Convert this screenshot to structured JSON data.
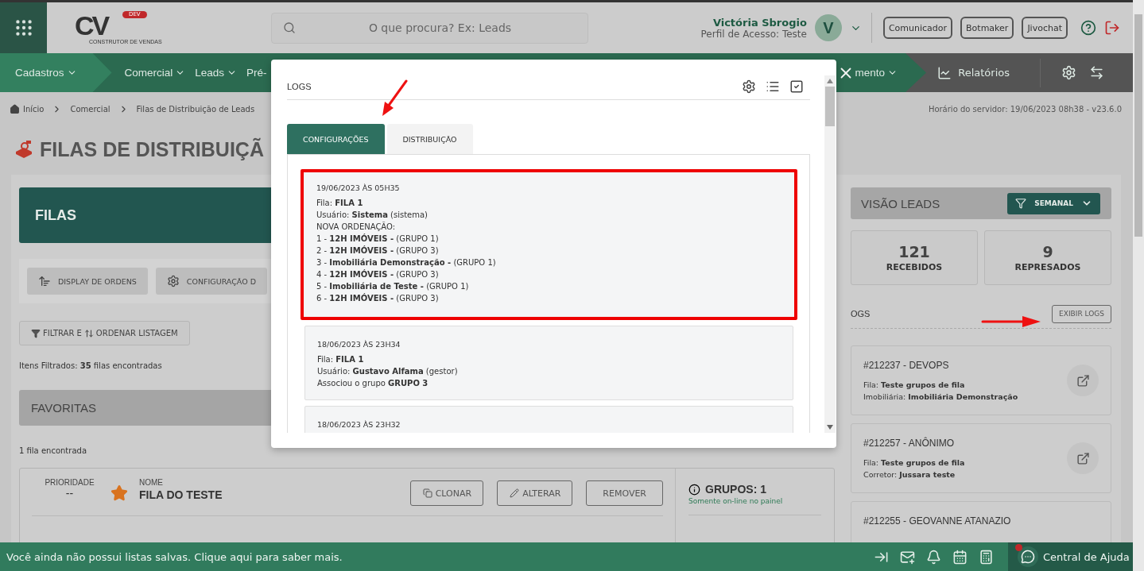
{
  "header": {
    "logo_mark": "CV",
    "logo_badge": "DEV",
    "logo_text": "CONSTRUTOR DE VENDAS",
    "search": {
      "placeholder": "O que procura? Ex: Leads"
    },
    "user": {
      "name": "Victória Sbrogio",
      "profile": "Perfil de Acesso: Teste",
      "initial": "V"
    },
    "buttons": [
      "Comunicador",
      "Botmaker",
      "Jivochat"
    ]
  },
  "nav": {
    "items": [
      {
        "label": "Cadastros",
        "selected": true
      },
      {
        "label": "Comercial",
        "selected": false
      },
      {
        "label": "Leads",
        "selected": false
      },
      {
        "label": "Pré-",
        "selected": false
      }
    ],
    "trailing": {
      "label": "mento",
      "selected": false
    },
    "reports": "Relatórios"
  },
  "breadcrumb": [
    "Início",
    "Comercial",
    "Filas de Distribuição de Leads"
  ],
  "server_time": "Horário do servidor: 19/06/2023 08h38 - v23.6.0",
  "page_title": "FILAS DE DISTRIBUIÇÃ",
  "filas": {
    "title": "FILAS",
    "actions": [
      "DISPLAY DE ORDENS",
      "CONFIGURAÇÃO D"
    ],
    "filter_button": [
      "FILTRAR E",
      "ORDENAR LISTAGEM"
    ],
    "count_text": "Itens Filtrados: **35** filas encontradas",
    "favorites": {
      "title": "FAVORITAS",
      "count_text": "1 fila encontrada",
      "queue": {
        "priority_label": "PRIORIDADE",
        "priority": "--",
        "favorite": true,
        "name_label": "NOME",
        "name": "FILA DO TESTE",
        "buttons": [
          "CLONAR",
          "ALTERAR",
          "REMOVER"
        ],
        "groups": "GRUPOS: 1",
        "groups_note": "Somente on-line no painel"
      }
    }
  },
  "overview": {
    "title": "VISÃO LEADS",
    "filter": "SEMANAL",
    "stats": [
      {
        "value": "121",
        "label": "RECEBIDOS"
      },
      {
        "value": "9",
        "label": "REPRESADOS"
      }
    ],
    "logs_title": "OGS",
    "logs_button": "EXIBIR LOGS",
    "leads": [
      {
        "title": "#212237 - DEVOPS",
        "lines": [
          "Fila: **Teste grupos de fila**",
          "Imobiliária: **Imobiliária Demonstração**"
        ]
      },
      {
        "title": "#212257 - ANÔNIMO",
        "lines": [
          "Fila: **Teste grupos de fila**",
          "Corretor: **Jussara teste**"
        ]
      },
      {
        "title": "#212255 - GEOVANNE ATANAZIO"
      }
    ]
  },
  "modal": {
    "title": "LOGS",
    "tabs": [
      {
        "label": "CONFIGURAÇÕES",
        "selected": true
      },
      {
        "label": "DISTRIBUIÇÃO",
        "selected": false
      }
    ],
    "entries": [
      {
        "date": "19/06/2023 ÀS 05H35",
        "highlighted": true,
        "lines": [
          "Fila: **FILA 1**",
          "Usuário: **Sistema** (sistema)",
          "NOVA ORDENAÇÃO:",
          "1 - **12H IMÓVEIS -** (GRUPO 1)",
          "2 - **12H IMÓVEIS -** (GRUPO 3)",
          "3 - **Imobiliária Demonstração -** (GRUPO 1)",
          "4 - **12H IMÓVEIS -** (GRUPO 3)",
          "5 - **Imobiliária de Teste -** (GRUPO 1)",
          "6 - **12H IMÓVEIS -** (GRUPO 3)"
        ]
      },
      {
        "date": "18/06/2023 ÀS 23H34",
        "highlighted": false,
        "lines": [
          "Fila: **FILA 1**",
          "Usuário: **Gustavo Alfama** (gestor)",
          "Associou o grupo **GRUPO 3**"
        ]
      },
      {
        "date": "18/06/2023 ÀS 23H32",
        "highlighted": false
      }
    ]
  },
  "footer": {
    "message": "Você ainda não possui listas salvas. Clique aqui para saber mais.",
    "help": "Central de Ajuda",
    "help_notification": true
  }
}
